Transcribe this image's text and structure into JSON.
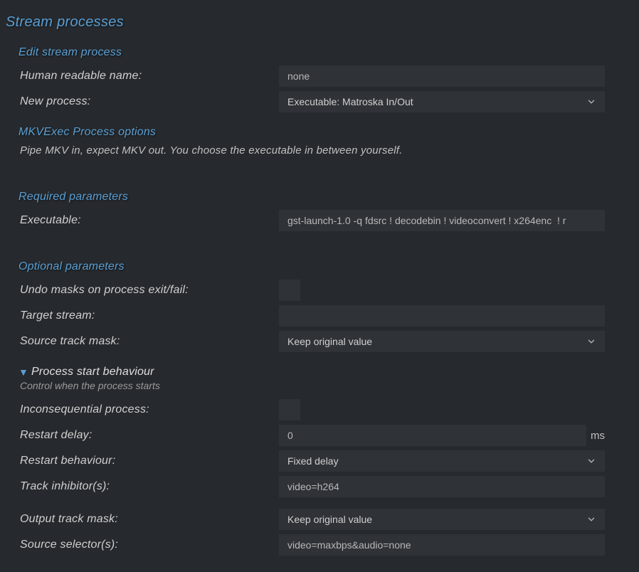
{
  "page": {
    "title": "Stream processes"
  },
  "edit": {
    "title": "Edit stream process",
    "name_label": "Human readable name:",
    "name_value": "none",
    "newproc_label": "New process:",
    "newproc_value": "Executable: Matroska In/Out"
  },
  "mkv": {
    "title": "MKVExec Process options",
    "desc": "Pipe MKV in, expect MKV out. You choose the executable in between yourself."
  },
  "required": {
    "title": "Required parameters",
    "exec_label": "Executable:",
    "exec_value": "gst-launch-1.0 -q fdsrc ! decodebin ! videoconvert ! x264enc  ! r"
  },
  "optional": {
    "title": "Optional parameters",
    "undo_label": "Undo masks on process exit/fail:",
    "target_label": "Target stream:",
    "target_value": "",
    "srcmask_label": "Source track mask:",
    "srcmask_value": "Keep original value"
  },
  "start": {
    "title": "Process start behaviour",
    "desc": "Control when the process starts",
    "inconsequential_label": "Inconsequential process:",
    "restart_delay_label": "Restart delay:",
    "restart_delay_value": "0",
    "restart_delay_suffix": "ms",
    "restart_behaviour_label": "Restart behaviour:",
    "restart_behaviour_value": "Fixed delay",
    "track_inhibitors_label": "Track inhibitor(s):",
    "track_inhibitors_value": "video=h264",
    "output_mask_label": "Output track mask:",
    "output_mask_value": "Keep original value",
    "source_selectors_label": "Source selector(s):",
    "source_selectors_value": "video=maxbps&audio=none"
  }
}
